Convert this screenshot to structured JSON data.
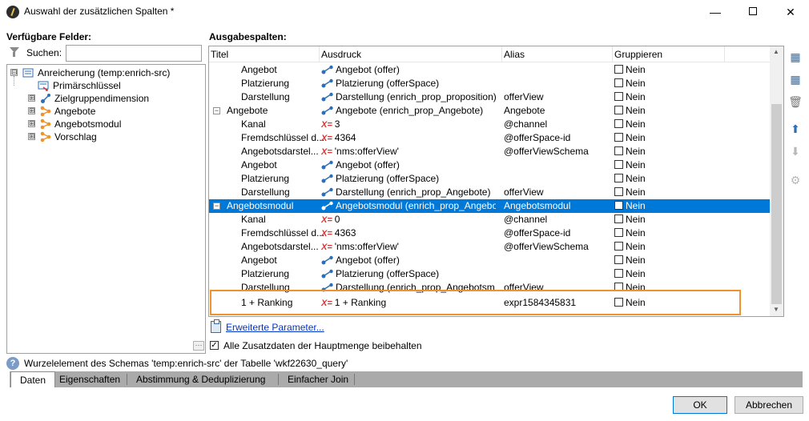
{
  "window": {
    "title": "Auswahl der zusätzlichen Spalten *",
    "minimize_glyph": "—",
    "close_glyph": "✕"
  },
  "left_panel": {
    "label": "Verfügbare Felder:",
    "search_label": "Suchen:",
    "search_value": "",
    "more_glyph": "···",
    "tree": [
      {
        "label": "Anreicherung (temp:enrich-src)",
        "expander": "⊟",
        "icon": "schema-root-icon"
      },
      {
        "label": "Primärschlüssel",
        "icon": "primary-key-icon"
      },
      {
        "label": "Zielgruppendimension",
        "expander": "⊞",
        "icon": "link-icon"
      },
      {
        "label": "Angebote",
        "expander": "⊞",
        "icon": "collection-icon"
      },
      {
        "label": "Angebotsmodul",
        "expander": "⊞",
        "icon": "collection-icon"
      },
      {
        "label": "Vorschlag",
        "expander": "⊞",
        "icon": "collection-icon"
      }
    ]
  },
  "right_panel": {
    "label": "Ausgabespalten:",
    "columns": [
      "Titel",
      "Ausdruck",
      "Alias",
      "Gruppieren"
    ],
    "rows": [
      {
        "title": "Angebot",
        "expr_icon": "link",
        "expr": "Angebot (offer)",
        "alias": "",
        "group": "Nein"
      },
      {
        "title": "Platzierung",
        "expr_icon": "link",
        "expr": "Platzierung (offerSpace)",
        "alias": "",
        "group": "Nein"
      },
      {
        "title": "Darstellung",
        "expr_icon": "link",
        "expr": "Darstellung (enrich_prop_proposition)",
        "alias": "offerView",
        "group": "Nein"
      },
      {
        "title": "Angebote",
        "parent": true,
        "expr_icon": "link",
        "expr": "Angebote (enrich_prop_Angebote)",
        "alias": "Angebote",
        "group": "Nein"
      },
      {
        "title": "Kanal",
        "expr_icon": "x",
        "expr": "3",
        "alias": "@channel",
        "group": "Nein"
      },
      {
        "title": "Fremdschlüssel d...",
        "expr_icon": "x",
        "expr": "4364",
        "alias": "@offerSpace-id",
        "group": "Nein"
      },
      {
        "title": "Angebotsdarstel...",
        "expr_icon": "x",
        "expr": "'nms:offerView'",
        "alias": "@offerViewSchema",
        "group": "Nein"
      },
      {
        "title": "Angebot",
        "expr_icon": "link",
        "expr": "Angebot (offer)",
        "alias": "",
        "group": "Nein"
      },
      {
        "title": "Platzierung",
        "expr_icon": "link",
        "expr": "Platzierung (offerSpace)",
        "alias": "",
        "group": "Nein"
      },
      {
        "title": "Darstellung",
        "expr_icon": "link",
        "expr": "Darstellung (enrich_prop_Angebote)",
        "alias": "offerView",
        "group": "Nein"
      },
      {
        "title": "Angebotsmodul",
        "parent": true,
        "selected": true,
        "expr_icon": "link",
        "expr": "Angebotsmodul (enrich_prop_Angebo...",
        "alias": "Angebotsmodul",
        "group": "Nein"
      },
      {
        "title": "Kanal",
        "expr_icon": "x",
        "expr": "0",
        "alias": "@channel",
        "group": "Nein"
      },
      {
        "title": "Fremdschlüssel d...",
        "expr_icon": "x",
        "expr": "4363",
        "alias": "@offerSpace-id",
        "group": "Nein"
      },
      {
        "title": "Angebotsdarstel...",
        "expr_icon": "x",
        "expr": "'nms:offerView'",
        "alias": "@offerViewSchema",
        "group": "Nein"
      },
      {
        "title": "Angebot",
        "expr_icon": "link",
        "expr": "Angebot (offer)",
        "alias": "",
        "group": "Nein"
      },
      {
        "title": "Platzierung",
        "expr_icon": "link",
        "expr": "Platzierung (offerSpace)",
        "alias": "",
        "group": "Nein"
      },
      {
        "title": "Darstellung",
        "expr_icon": "link",
        "expr": "Darstellung (enrich_prop_Angebotsm...",
        "alias": "offerView",
        "group": "Nein"
      },
      {
        "title": "1 + Ranking",
        "highlighted": true,
        "expr_icon": "x",
        "expr": "1 + Ranking",
        "alias": "expr1584345831",
        "group": "Nein"
      }
    ],
    "x_icon_glyph": "X=",
    "advanced_params": "Erweiterte Parameter...",
    "keep_label": "Alle Zusatzdaten der Hauptmenge beibehalten",
    "keep_checked": true
  },
  "side_tools": [
    {
      "name": "add-column-icon",
      "glyph": "▦"
    },
    {
      "name": "add-expression-icon",
      "glyph": "▦"
    },
    {
      "name": "delete-icon",
      "glyph": "🗑"
    },
    {
      "name": "move-up-icon",
      "glyph": "⬆"
    },
    {
      "name": "move-down-icon",
      "glyph": "⬇"
    },
    {
      "name": "settings-icon",
      "glyph": "⚙"
    }
  ],
  "status": {
    "help_glyph": "?",
    "text": "Wurzelelement des Schemas 'temp:enrich-src' der Tabelle 'wkf22630_query'"
  },
  "tabs": [
    "Daten",
    "Eigenschaften",
    "Abstimmung & Deduplizierung",
    "Einfacher Join"
  ],
  "buttons": {
    "ok": "OK",
    "cancel": "Abbrechen"
  },
  "colors": {
    "selection": "#0078d7",
    "highlight_border": "#f0922e",
    "link": "#0033cc",
    "x_icon": "#e03131"
  }
}
